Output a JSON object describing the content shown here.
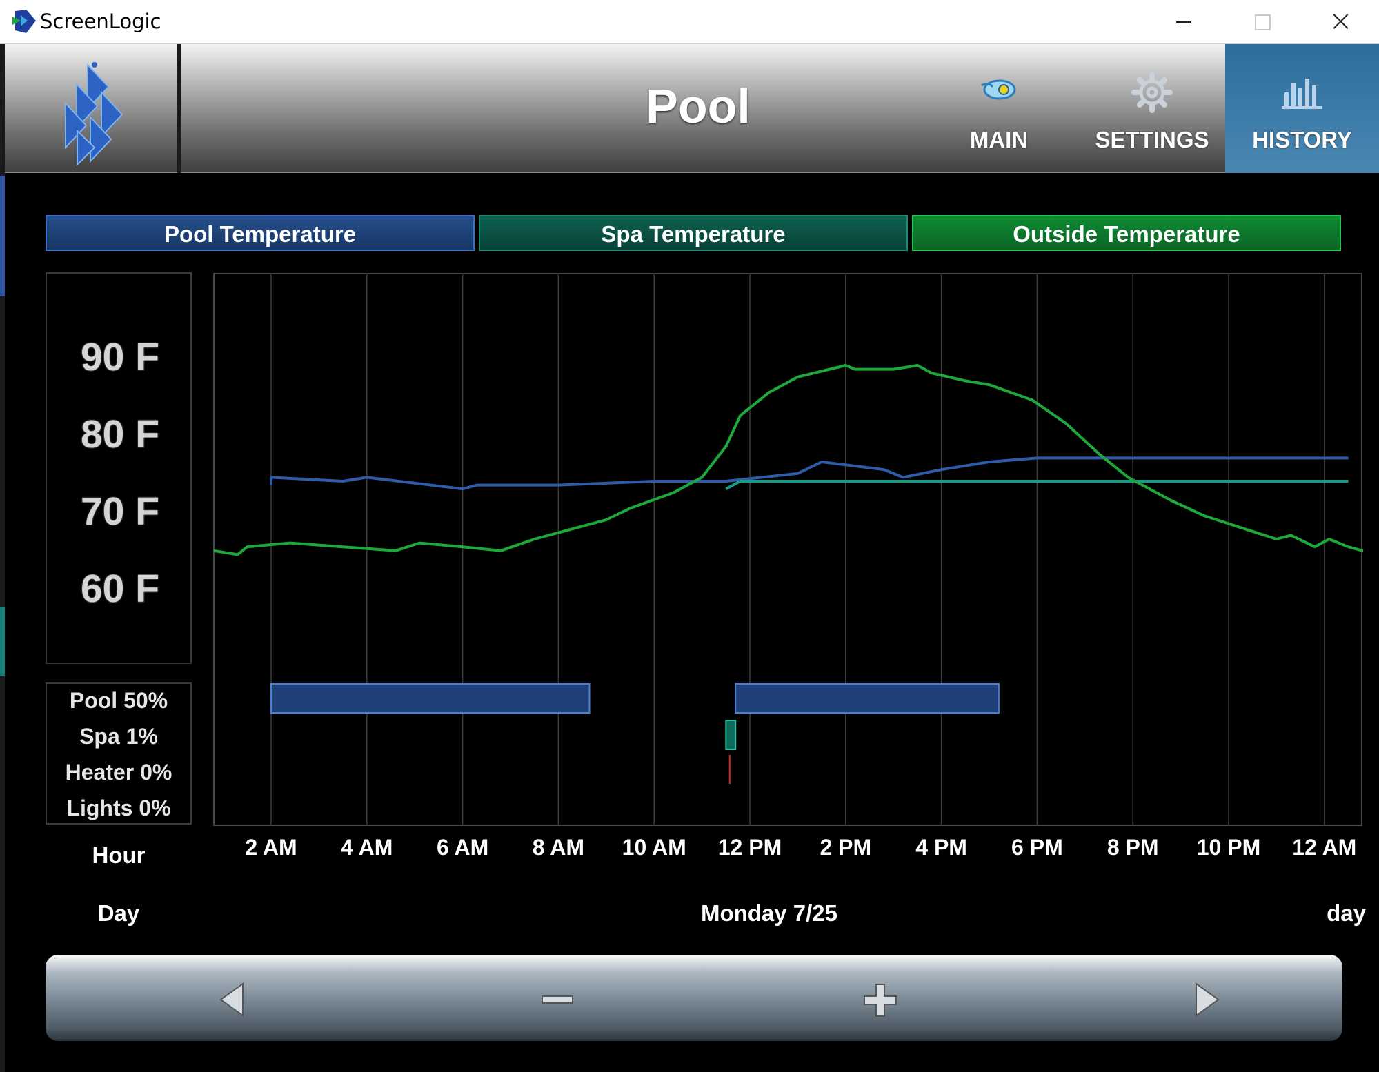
{
  "window": {
    "title": "ScreenLogic"
  },
  "header": {
    "title": "Pool",
    "nav": [
      {
        "label": "MAIN",
        "icon": "pool-light-icon"
      },
      {
        "label": "SETTINGS",
        "icon": "gear-icon"
      },
      {
        "label": "HISTORY",
        "icon": "bar-chart-icon",
        "active": true
      }
    ]
  },
  "legend": {
    "pool": "Pool Temperature",
    "spa": "Spa Temperature",
    "outside": "Outside Temperature"
  },
  "y_axis": {
    "ticks": [
      "90 F",
      "80 F",
      "70 F",
      "60 F"
    ]
  },
  "stats": [
    "Pool 50%",
    "Spa 1%",
    "Heater 0%",
    "Lights 0%"
  ],
  "footer": {
    "hour_label": "Hour",
    "day_label": "Day",
    "date": "Monday 7/25",
    "day_right": "day"
  },
  "colors": {
    "pool": "#2f5ca8",
    "spa": "#1a9b86",
    "outside": "#1ea83c",
    "heater": "#d0302a",
    "grid": "#3c3c3c"
  },
  "chart_data": {
    "type": "line",
    "x_unit": "hour",
    "x_ticks": [
      "2 AM",
      "4 AM",
      "6 AM",
      "8 AM",
      "10 AM",
      "12 PM",
      "2 PM",
      "4 PM",
      "6 PM",
      "8 PM",
      "10 PM",
      "12 AM"
    ],
    "ylim": [
      52,
      102
    ],
    "series": [
      {
        "name": "Pool Temperature",
        "color": "#2f5ca8",
        "points": [
          [
            2,
            72
          ],
          [
            2,
            73
          ],
          [
            3.5,
            72.5
          ],
          [
            4,
            73
          ],
          [
            6,
            71.5
          ],
          [
            6.3,
            72
          ],
          [
            8,
            72
          ],
          [
            10,
            72.5
          ],
          [
            11.5,
            72.5
          ],
          [
            13,
            73.5
          ],
          [
            13.5,
            75
          ],
          [
            14.8,
            74
          ],
          [
            15.2,
            73
          ],
          [
            16,
            74
          ],
          [
            17,
            75
          ],
          [
            18,
            75.5
          ],
          [
            20,
            75.5
          ],
          [
            24.5,
            75.5
          ]
        ]
      },
      {
        "name": "Spa Temperature",
        "color": "#1a9b86",
        "points": [
          [
            11.5,
            71.5
          ],
          [
            11.8,
            72.5
          ],
          [
            12,
            72.5
          ],
          [
            24.5,
            72.5
          ]
        ]
      },
      {
        "name": "Outside Temperature",
        "color": "#1ea83c",
        "points": [
          [
            0.8,
            63.5
          ],
          [
            1.3,
            63
          ],
          [
            1.5,
            64
          ],
          [
            2.4,
            64.5
          ],
          [
            3.5,
            64
          ],
          [
            4.6,
            63.5
          ],
          [
            5.1,
            64.5
          ],
          [
            6.0,
            64
          ],
          [
            6.8,
            63.5
          ],
          [
            7.5,
            65
          ],
          [
            8.1,
            66
          ],
          [
            9.0,
            67.5
          ],
          [
            9.5,
            69
          ],
          [
            10.4,
            71
          ],
          [
            11.0,
            73
          ],
          [
            11.5,
            77
          ],
          [
            11.8,
            81
          ],
          [
            12.4,
            84
          ],
          [
            13.0,
            86
          ],
          [
            14.0,
            87.5
          ],
          [
            14.2,
            87
          ],
          [
            15.0,
            87
          ],
          [
            15.5,
            87.5
          ],
          [
            15.8,
            86.5
          ],
          [
            16.5,
            85.5
          ],
          [
            17.0,
            85
          ],
          [
            17.9,
            83
          ],
          [
            18.6,
            80
          ],
          [
            19.3,
            76
          ],
          [
            19.9,
            73
          ],
          [
            20.8,
            70
          ],
          [
            21.5,
            68
          ],
          [
            22.0,
            67
          ],
          [
            22.5,
            66
          ],
          [
            23.0,
            65
          ],
          [
            23.3,
            65.5
          ],
          [
            23.8,
            64
          ],
          [
            24.1,
            65
          ],
          [
            24.5,
            64
          ],
          [
            24.8,
            63.5
          ],
          [
            25.0,
            64
          ],
          [
            25.3,
            64
          ]
        ]
      }
    ],
    "activity_bars": [
      {
        "name": "Pool",
        "color": "#2f5ca8",
        "ranges": [
          [
            2,
            8.65
          ],
          [
            11.7,
            17.2
          ]
        ]
      },
      {
        "name": "Spa",
        "color": "#1a9b86",
        "ranges": [
          [
            11.5,
            11.7
          ]
        ]
      },
      {
        "name": "Heater",
        "color": "#d0302a",
        "ranges": [
          [
            11.55,
            11.6
          ]
        ]
      }
    ]
  }
}
